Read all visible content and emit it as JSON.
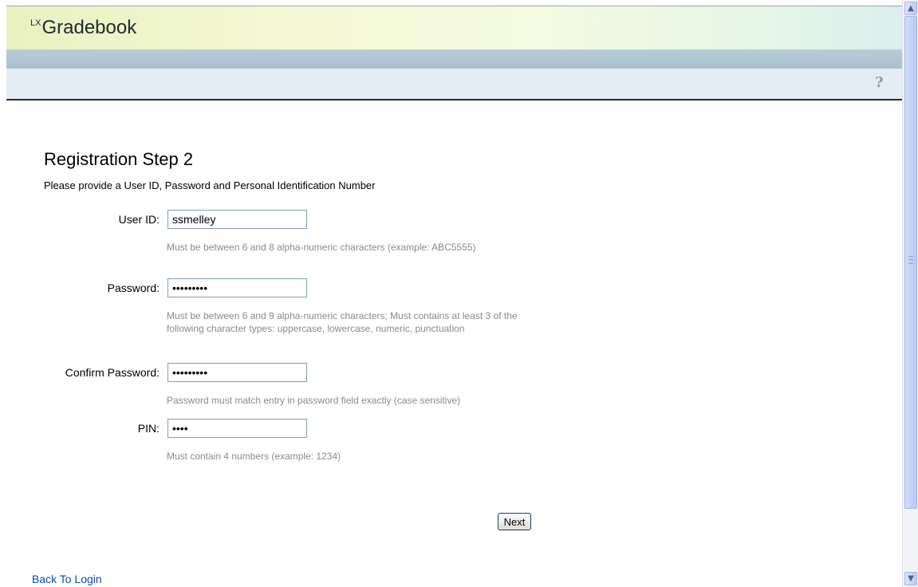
{
  "header": {
    "logo_prefix": "LX",
    "logo_text": "Gradebook",
    "help_icon": "question-mark-icon"
  },
  "form": {
    "title": "Registration Step 2",
    "subtitle": "Please provide a User ID, Password and Personal Identification Number",
    "user_id": {
      "label": "User ID:",
      "value": "ssmelley",
      "hint": "Must be between 6 and 8 alpha-numeric characters (example: ABC5555)"
    },
    "password": {
      "label": "Password:",
      "value": "•••••••••",
      "hint": "Must be between 6 and 9 alpha-numeric characters; Must contains at least 3 of the following character types: uppercase, lowercase, numeric, punctuation"
    },
    "confirm_password": {
      "label": "Confirm Password:",
      "value": "•••••••••",
      "hint": "Password must match entry in password field exactly (case sensitive)"
    },
    "pin": {
      "label": "PIN:",
      "value": "••••",
      "hint": "Must contain 4 numbers (example: 1234)"
    },
    "next_label": "Next"
  },
  "footer": {
    "back_link": "Back To Login"
  },
  "scrollbar": {
    "up_arrow": "▲",
    "down_arrow": "▼"
  }
}
